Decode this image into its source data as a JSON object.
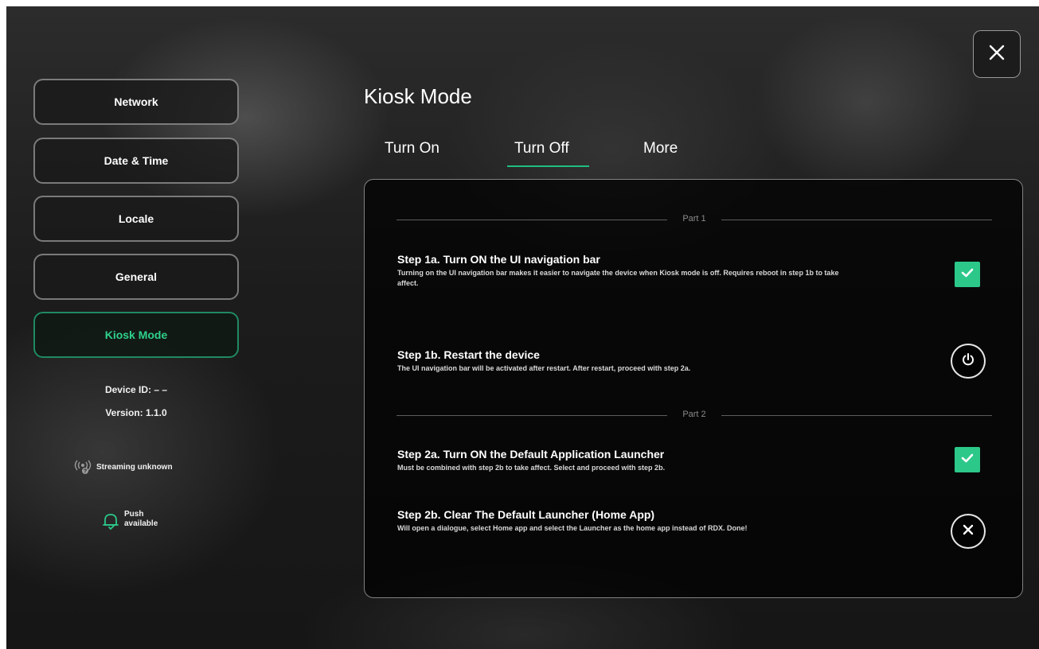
{
  "sidebar": {
    "items": [
      {
        "label": "Network"
      },
      {
        "label": "Date & Time"
      },
      {
        "label": "Locale"
      },
      {
        "label": "General"
      },
      {
        "label": "Kiosk Mode"
      }
    ],
    "active_item": "Kiosk Mode",
    "device_id": "Device ID: – –",
    "version": "Version:  1.1.0",
    "streaming_status": "Streaming unknown",
    "push_status_line1": "Push",
    "push_status_line2": "available"
  },
  "header": {
    "title": "Kiosk Mode"
  },
  "tabs": [
    {
      "label": "Turn On"
    },
    {
      "label": "Turn Off"
    },
    {
      "label": "More"
    }
  ],
  "active_tab": "Turn Off",
  "panel": {
    "part1_label": "Part 1",
    "part2_label": "Part 2",
    "steps": [
      {
        "title": "Step 1a. Turn ON the UI navigation bar",
        "description": "Turning on the UI navigation bar makes it easier to navigate the device when Kiosk mode is off. Requires reboot in step 1b to take affect.",
        "control": "checkbox",
        "checked": true
      },
      {
        "title": "Step 1b. Restart the device",
        "description": "The UI navigation bar will be activated after restart. After restart, proceed with step 2a.",
        "control": "power-button"
      },
      {
        "title": "Step 2a. Turn ON the Default Application Launcher",
        "description": "Must be combined with step 2b to take affect. Select and proceed with step 2b.",
        "control": "checkbox",
        "checked": true
      },
      {
        "title": "Step 2b. Clear The Default Launcher (Home App)",
        "description": "Will open a dialogue, select Home app and select the Launcher as the home app instead of RDX. Done!",
        "control": "clear-button"
      }
    ]
  },
  "icons": {
    "close": "close-icon",
    "check": "check-icon",
    "power": "power-icon",
    "clear": "x-icon",
    "streaming": "streaming-signal-icon",
    "push": "bell-icon"
  },
  "colors": {
    "accent": "#2cc88a",
    "active_text": "#2fd18b",
    "tab_underline": "#1fbf80"
  }
}
